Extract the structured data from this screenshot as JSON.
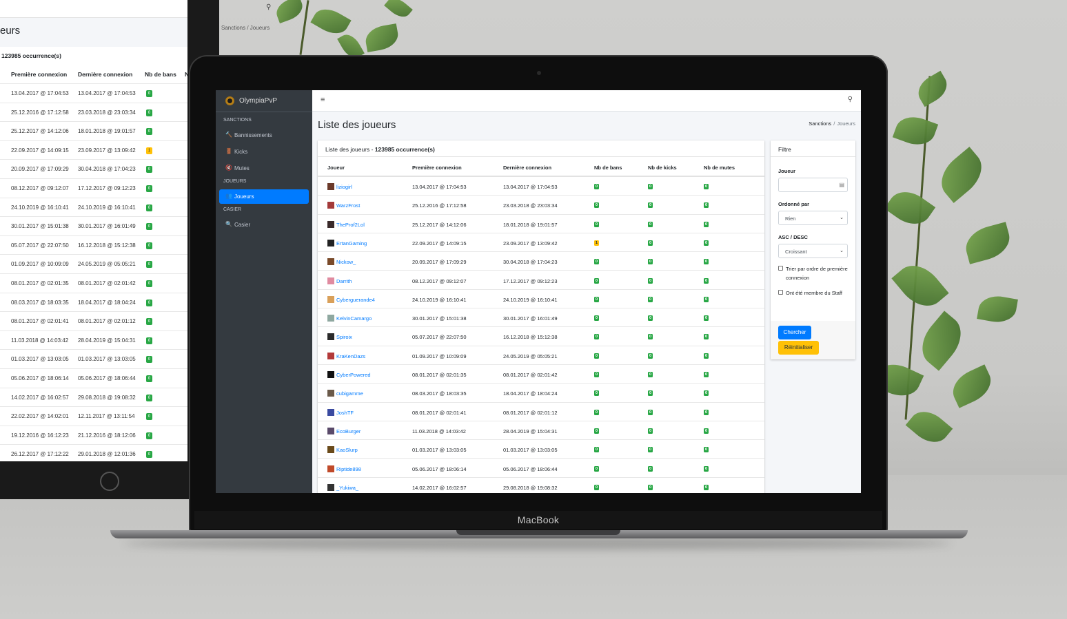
{
  "background_panel": {
    "title": "eurs",
    "breadcrumb": "Sanctions  /  Joueurs",
    "count": "123985 occurrence(s)",
    "headers": [
      "Première connexion",
      "Dernière connexion",
      "Nb de bans",
      "N"
    ],
    "rows": [
      [
        "13.04.2017 @ 17:04:53",
        "13.04.2017 @ 17:04:53",
        "0"
      ],
      [
        "25.12.2016 @ 17:12:58",
        "23.03.2018 @ 23:03:34",
        "0"
      ],
      [
        "25.12.2017 @ 14:12:06",
        "18.01.2018 @ 19:01:57",
        "0"
      ],
      [
        "22.09.2017 @ 14:09:15",
        "23.09.2017 @ 13:09:42",
        "1"
      ],
      [
        "20.09.2017 @ 17:09:29",
        "30.04.2018 @ 17:04:23",
        "0"
      ],
      [
        "08.12.2017 @ 09:12:07",
        "17.12.2017 @ 09:12:23",
        "0"
      ],
      [
        "24.10.2019 @ 16:10:41",
        "24.10.2019 @ 16:10:41",
        "0"
      ],
      [
        "30.01.2017 @ 15:01:38",
        "30.01.2017 @ 16:01:49",
        "0"
      ],
      [
        "05.07.2017 @ 22:07:50",
        "16.12.2018 @ 15:12:38",
        "0"
      ],
      [
        "01.09.2017 @ 10:09:09",
        "24.05.2019 @ 05:05:21",
        "0"
      ],
      [
        "08.01.2017 @ 02:01:35",
        "08.01.2017 @ 02:01:42",
        "0"
      ],
      [
        "08.03.2017 @ 18:03:35",
        "18.04.2017 @ 18:04:24",
        "0"
      ],
      [
        "08.01.2017 @ 02:01:41",
        "08.01.2017 @ 02:01:12",
        "0"
      ],
      [
        "11.03.2018 @ 14:03:42",
        "28.04.2019 @ 15:04:31",
        "0"
      ],
      [
        "01.03.2017 @ 13:03:05",
        "01.03.2017 @ 13:03:05",
        "0"
      ],
      [
        "05.06.2017 @ 18:06:14",
        "05.06.2017 @ 18:06:44",
        "0"
      ],
      [
        "14.02.2017 @ 16:02:57",
        "29.08.2018 @ 19:08:32",
        "0"
      ],
      [
        "22.02.2017 @ 14:02:01",
        "12.11.2017 @ 13:11:54",
        "0"
      ],
      [
        "19.12.2016 @ 16:12:23",
        "21.12.2016 @ 18:12:06",
        "0"
      ],
      [
        "26.12.2017 @ 17:12:22",
        "29.01.2018 @ 12:01:36",
        "0"
      ]
    ]
  },
  "laptop_label": "MacBook",
  "app": {
    "brand": "OlympiaPvP",
    "sidebar": {
      "sections": [
        {
          "header": "SANCTIONS",
          "items": [
            {
              "label": "Bannissements",
              "icon": "gavel-icon",
              "glyph": "🔨",
              "active": false
            },
            {
              "label": "Kicks",
              "icon": "door-icon",
              "glyph": "🚪",
              "active": false
            },
            {
              "label": "Mutes",
              "icon": "muted-icon",
              "glyph": "🔇",
              "active": false
            }
          ]
        },
        {
          "header": "JOUEURS",
          "items": [
            {
              "label": "Joueurs",
              "icon": "users-icon",
              "glyph": "👥",
              "active": true
            }
          ]
        },
        {
          "header": "CASIER",
          "items": [
            {
              "label": "Casier",
              "icon": "search-icon",
              "glyph": "🔍",
              "active": false
            }
          ]
        }
      ]
    },
    "topbar": {
      "menu_glyph": "≡",
      "search_glyph": "⚲"
    },
    "page_title": "Liste des joueurs",
    "breadcrumb": {
      "parent": "Sanctions",
      "current": "Joueurs"
    },
    "table": {
      "title_prefix": "Liste des joueurs - ",
      "title_count": "123985 occurrence(s)",
      "headers": [
        "Joueur",
        "Première connexion",
        "Dernière connexion",
        "Nb de bans",
        "Nb de kicks",
        "Nb de mutes"
      ],
      "rows": [
        {
          "player": "liziogirl",
          "first": "13.04.2017 @ 17:04:53",
          "last": "13.04.2017 @ 17:04:53",
          "bans": "0",
          "kicks": "0",
          "mutes": "0",
          "avatar": "#6b3a2a"
        },
        {
          "player": "WarzFrost",
          "first": "25.12.2016 @ 17:12:58",
          "last": "23.03.2018 @ 23:03:34",
          "bans": "0",
          "kicks": "0",
          "mutes": "0",
          "avatar": "#a33a3a"
        },
        {
          "player": "TheProf2Lol",
          "first": "25.12.2017 @ 14:12:06",
          "last": "18.01.2018 @ 19:01:57",
          "bans": "0",
          "kicks": "0",
          "mutes": "0",
          "avatar": "#3a2a2a"
        },
        {
          "player": "ErtanGaming",
          "first": "22.09.2017 @ 14:09:15",
          "last": "23.09.2017 @ 13:09:42",
          "bans": "1",
          "kicks": "0",
          "mutes": "0",
          "avatar": "#222222"
        },
        {
          "player": "Nickow_",
          "first": "20.09.2017 @ 17:09:29",
          "last": "30.04.2018 @ 17:04:23",
          "bans": "0",
          "kicks": "0",
          "mutes": "0",
          "avatar": "#7a4a2a"
        },
        {
          "player": "Darrith",
          "first": "08.12.2017 @ 09:12:07",
          "last": "17.12.2017 @ 09:12:23",
          "bans": "0",
          "kicks": "0",
          "mutes": "0",
          "avatar": "#e08ba0"
        },
        {
          "player": "Cyberguerande4",
          "first": "24.10.2019 @ 16:10:41",
          "last": "24.10.2019 @ 16:10:41",
          "bans": "0",
          "kicks": "0",
          "mutes": "0",
          "avatar": "#d9a05a"
        },
        {
          "player": "KelvinCamargo",
          "first": "30.01.2017 @ 15:01:38",
          "last": "30.01.2017 @ 16:01:49",
          "bans": "0",
          "kicks": "0",
          "mutes": "0",
          "avatar": "#8fa8a0"
        },
        {
          "player": "Spiroix",
          "first": "05.07.2017 @ 22:07:50",
          "last": "16.12.2018 @ 15:12:38",
          "bans": "0",
          "kicks": "0",
          "mutes": "0",
          "avatar": "#2a2a2a"
        },
        {
          "player": "KraKenDazs",
          "first": "01.09.2017 @ 10:09:09",
          "last": "24.05.2019 @ 05:05:21",
          "bans": "0",
          "kicks": "0",
          "mutes": "0",
          "avatar": "#b33a3a"
        },
        {
          "player": "CyberPowered",
          "first": "08.01.2017 @ 02:01:35",
          "last": "08.01.2017 @ 02:01:42",
          "bans": "0",
          "kicks": "0",
          "mutes": "0",
          "avatar": "#111111"
        },
        {
          "player": "cubigamme",
          "first": "08.03.2017 @ 18:03:35",
          "last": "18.04.2017 @ 18:04:24",
          "bans": "0",
          "kicks": "0",
          "mutes": "0",
          "avatar": "#6a5a4a"
        },
        {
          "player": "JoshTF",
          "first": "08.01.2017 @ 02:01:41",
          "last": "08.01.2017 @ 02:01:12",
          "bans": "0",
          "kicks": "0",
          "mutes": "0",
          "avatar": "#3a4aa0"
        },
        {
          "player": "EcoBurger",
          "first": "11.03.2018 @ 14:03:42",
          "last": "28.04.2019 @ 15:04:31",
          "bans": "0",
          "kicks": "0",
          "mutes": "0",
          "avatar": "#5a4a6a"
        },
        {
          "player": "KaoSlurp",
          "first": "01.03.2017 @ 13:03:05",
          "last": "01.03.2017 @ 13:03:05",
          "bans": "0",
          "kicks": "0",
          "mutes": "0",
          "avatar": "#6a4a1a"
        },
        {
          "player": "Riptide898",
          "first": "05.06.2017 @ 18:06:14",
          "last": "05.06.2017 @ 18:06:44",
          "bans": "0",
          "kicks": "0",
          "mutes": "0",
          "avatar": "#c04a2a"
        },
        {
          "player": "_Yukiwa_",
          "first": "14.02.2017 @ 16:02:57",
          "last": "29.08.2018 @ 19:08:32",
          "bans": "0",
          "kicks": "0",
          "mutes": "0",
          "avatar": "#333333"
        }
      ]
    },
    "filter": {
      "title": "Filtre",
      "player_label": "Joueur",
      "player_value": "",
      "order_label": "Ordonné par",
      "order_value": "Rien",
      "direction_label": "ASC / DESC",
      "direction_value": "Croissant",
      "check_first": "Trier par ordre de première connexion",
      "check_staff": "Ont été membre du Staff",
      "search_button": "Chercher",
      "reset_button": "Réinitialiser"
    },
    "colors": {
      "primary": "#007bff",
      "success": "#28a745",
      "warning": "#ffc107",
      "sidebar": "#343a40"
    }
  }
}
